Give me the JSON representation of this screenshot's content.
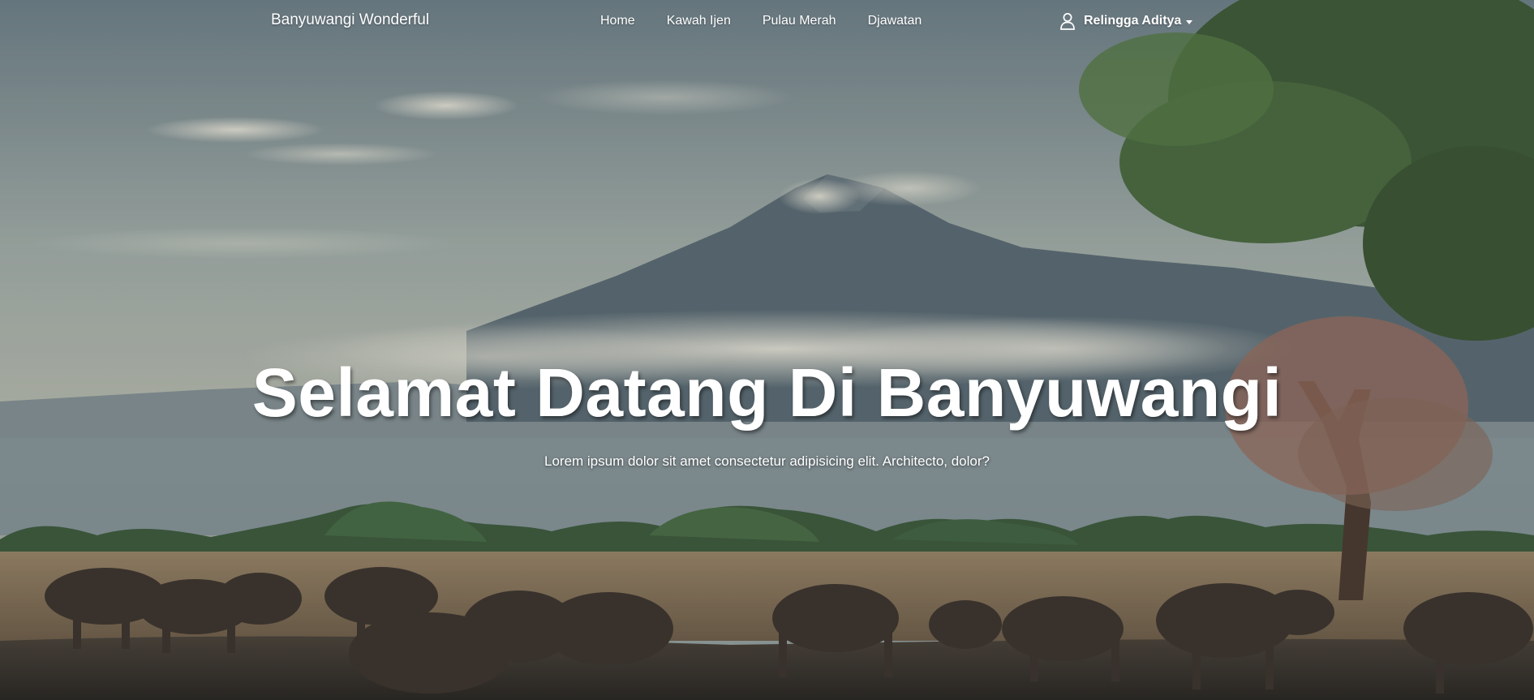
{
  "navbar": {
    "brand": "Banyuwangi Wonderful",
    "links": [
      {
        "label": "Home"
      },
      {
        "label": "Kawah Ijen"
      },
      {
        "label": "Pulau Merah"
      },
      {
        "label": "Djawatan"
      }
    ],
    "user": {
      "name": "Relingga Aditya",
      "icon": "user-icon",
      "dropdown_icon": "caret-down-icon"
    }
  },
  "hero": {
    "title": "Selamat Datang Di Banyuwangi",
    "subtitle": "Lorem ipsum dolor sit amet consectetur adipisicing elit. Architecto, dolor?",
    "background": "landscape-photo"
  },
  "colors": {
    "sky": "#9aa8a8",
    "mountain": "#5a6b72",
    "field": "#8a7457",
    "ground": "#3a342d",
    "text": "#ffffff"
  }
}
